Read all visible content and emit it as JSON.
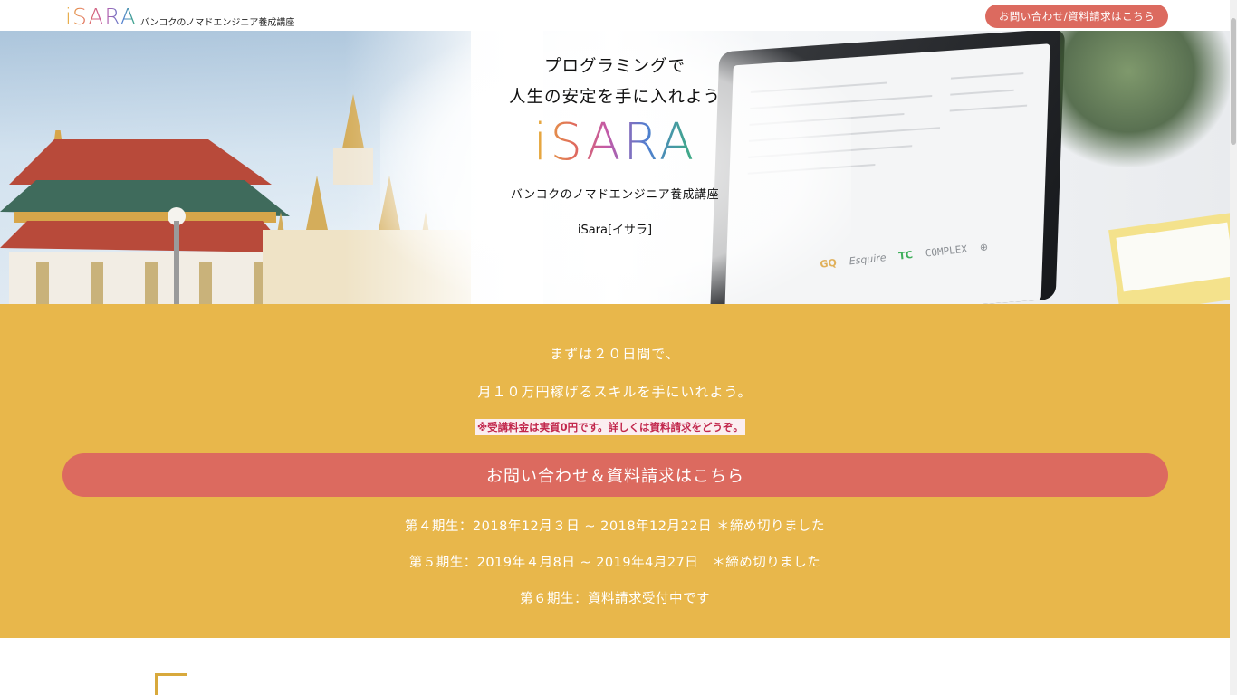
{
  "header": {
    "logo_text": "iSARA",
    "logo_subtitle": "バンコクのノマドエンジニア養成講座",
    "contact_button": "お問い合わせ/資料請求はこちら"
  },
  "hero": {
    "line1": "プログラミングで",
    "line2": "人生の安定を手に入れよう",
    "logo_text": "iSARA",
    "subtitle": "バンコクのノマドエンジニア養成講座",
    "name": "iSara[イサラ]",
    "brands": [
      "GQ",
      "Esquire",
      "TC",
      "COMPLEX",
      "⊕"
    ]
  },
  "cta": {
    "line1": "まずは２０日間で、",
    "line2": "月１０万円稼げるスキルを手にいれよう。",
    "note": "※受講料金は実質0円です。詳しくは資料請求をどうぞ。",
    "button": "お問い合わせ＆資料請求はこちら",
    "terms": [
      "第４期生：2018年12月３日 ~ 2018年12月22日 ＊締め切りました",
      "第５期生：2019年４月8日 ~ 2019年4月27日　＊締め切りました",
      "第６期生：資料請求受付中です"
    ]
  },
  "colors": {
    "accent": "#dc6a5f",
    "section_bg": "#e8b74b",
    "note_text": "#c2284d"
  }
}
